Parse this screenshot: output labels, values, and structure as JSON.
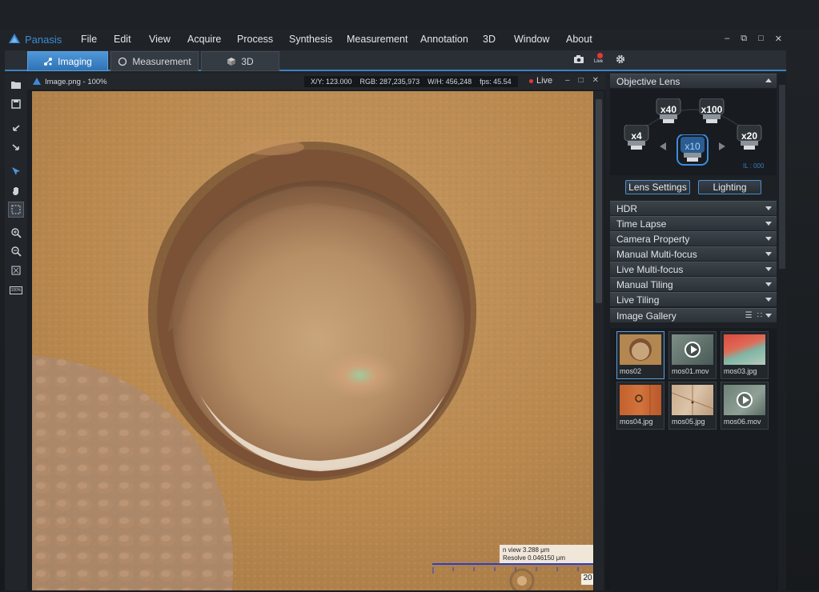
{
  "app": {
    "name": "Panasis",
    "accent": "#3b82c4"
  },
  "menu": [
    "File",
    "Edit",
    "View",
    "Acquire",
    "Process",
    "Synthesis",
    "Measurement",
    "Annotation",
    "3D",
    "Window",
    "About"
  ],
  "window_controls": [
    "minimize-icon",
    "restore-icon",
    "maximize-icon",
    "close-icon"
  ],
  "tabs": [
    {
      "label": "Imaging",
      "icon": "imaging-icon",
      "active": true
    },
    {
      "label": "Measurement",
      "icon": "measurement-icon",
      "active": false
    },
    {
      "label": "3D",
      "icon": "cube-icon",
      "active": false
    }
  ],
  "tab_tools": {
    "camera": "camera-icon",
    "live": "Live",
    "settings": "gear-icon"
  },
  "left_tools": [
    "open-folder-icon",
    "save-icon",
    "undo-icon",
    "redo-icon",
    "select-arrow-icon",
    "pan-hand-icon",
    "rect-select-icon",
    "zoom-in-icon",
    "zoom-out-icon",
    "fit-icon",
    "zoom-100-icon"
  ],
  "zoom_badge": "100%",
  "viewer": {
    "title": "Image.png - 100%",
    "xy": "X/Y: 123.000",
    "rgb": "RGB: 287,235,973",
    "wh": "W/H: 456,248",
    "fps": "fps: 45.54",
    "live": "Live",
    "scale_line1": "n  view  3.288  μm",
    "scale_line2": "Resolve 0.046150  μm",
    "scale_value": "20"
  },
  "right_panel": {
    "objective": {
      "title": "Objective Lens",
      "lenses": [
        {
          "label": "x40",
          "selected": false
        },
        {
          "label": "x100",
          "selected": false
        },
        {
          "label": "x4",
          "selected": false
        },
        {
          "label": "x20",
          "selected": false
        },
        {
          "label": "x10",
          "selected": true
        }
      ],
      "il": "IL : 000",
      "buttons": [
        "Lens Settings",
        "Lighting"
      ]
    },
    "sections": [
      "HDR",
      "Time Lapse",
      "Camera Property",
      "Manual Multi-focus",
      "Live Multi-focus",
      "Manual Tiling",
      "Live Tiling"
    ],
    "gallery": {
      "title": "Image Gallery",
      "items": [
        {
          "name": "mos02",
          "video": false,
          "selected": true
        },
        {
          "name": "mos01.mov",
          "video": true,
          "selected": false
        },
        {
          "name": "mos03.jpg",
          "video": false,
          "selected": false
        },
        {
          "name": "mos04.jpg",
          "video": false,
          "selected": false
        },
        {
          "name": "mos05.jpg",
          "video": false,
          "selected": false
        },
        {
          "name": "mos06.mov",
          "video": true,
          "selected": false
        }
      ]
    }
  }
}
